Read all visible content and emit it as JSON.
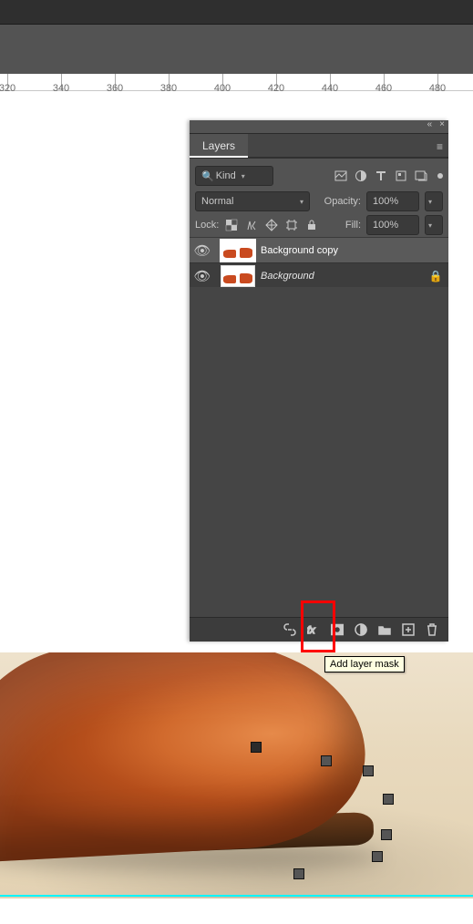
{
  "ruler": {
    "start": 320,
    "step": 20,
    "labels": [
      "320",
      "340",
      "360",
      "380",
      "400",
      "420",
      "440",
      "460",
      "480"
    ]
  },
  "panel": {
    "title": "Layers",
    "collapse": "«",
    "close": "×",
    "menu": "≡",
    "filter_dropdown": {
      "icon": "🔍",
      "label": "Kind"
    },
    "blend_mode": "Normal",
    "opacity_label": "Opacity:",
    "opacity_value": "100%",
    "lock_label": "Lock:",
    "fill_label": "Fill:",
    "fill_value": "100%",
    "layers": [
      {
        "name": "Background copy",
        "locked": false,
        "selected": true
      },
      {
        "name": "Background",
        "locked": true,
        "selected": false
      }
    ],
    "tooltip": "Add layer mask"
  }
}
